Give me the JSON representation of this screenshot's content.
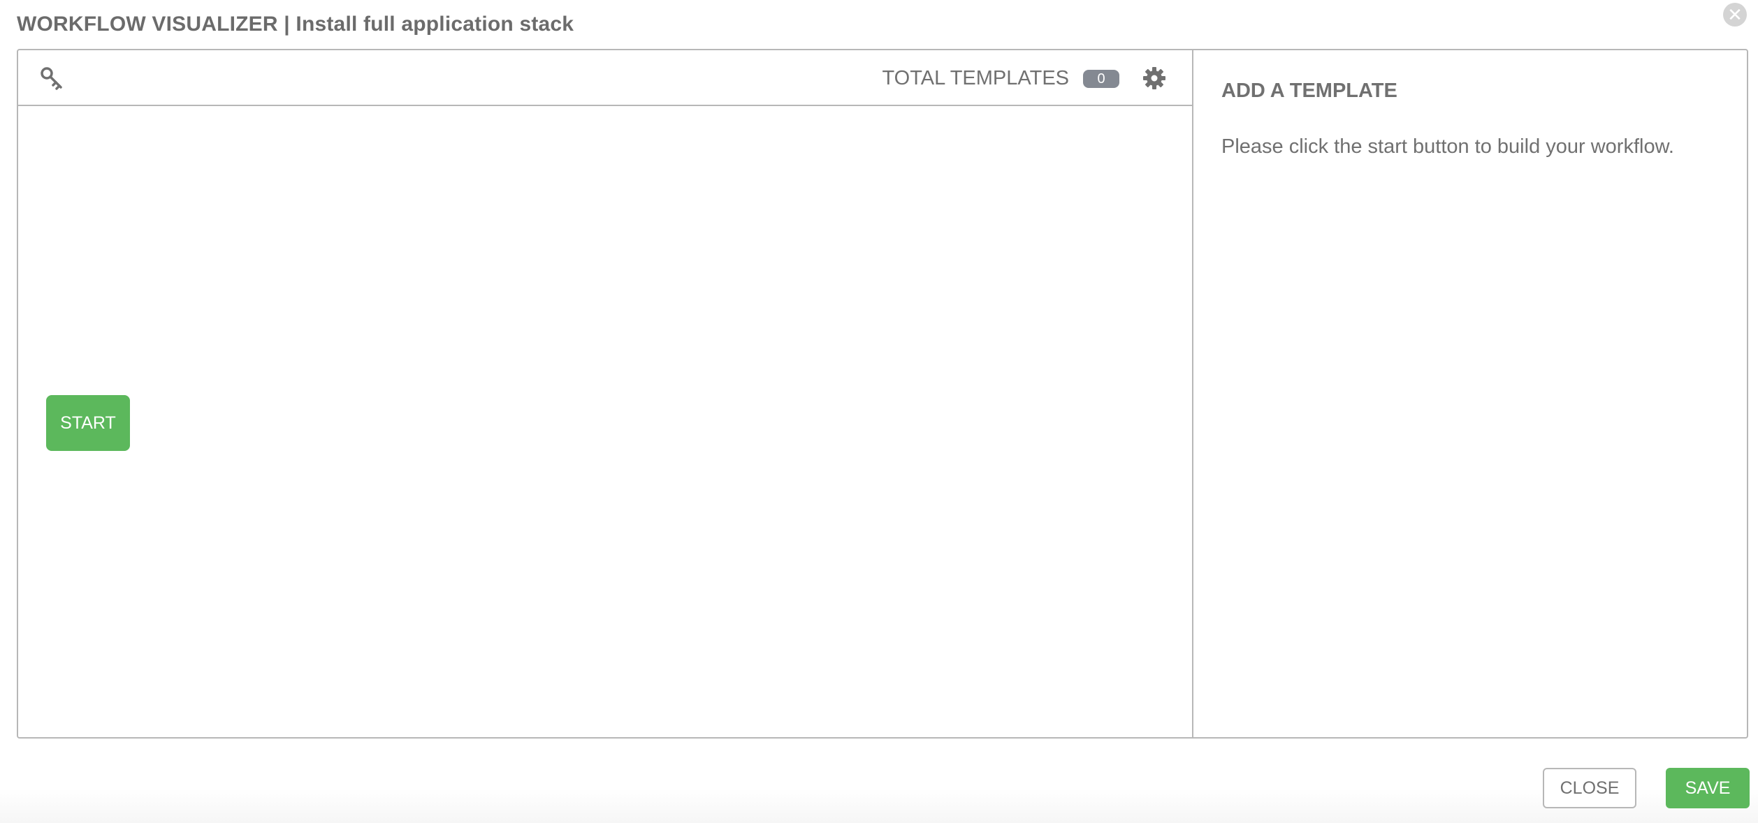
{
  "modal": {
    "title": "WORKFLOW VISUALIZER | Install full application stack",
    "close_icon": "close-circle-icon"
  },
  "toolbar": {
    "key_icon": "key-icon",
    "total_label": "TOTAL TEMPLATES",
    "total_count": "0",
    "settings_icon": "gear-icon"
  },
  "canvas": {
    "start_label": "START"
  },
  "side_panel": {
    "heading": "ADD A TEMPLATE",
    "instructions": "Please click the start button to build your workflow."
  },
  "footer": {
    "close_label": "CLOSE",
    "save_label": "SAVE"
  },
  "colors": {
    "accent_green": "#5cb85c",
    "badge_gray": "#848992",
    "border_gray": "#b7b7b7",
    "text_gray": "#707070"
  }
}
